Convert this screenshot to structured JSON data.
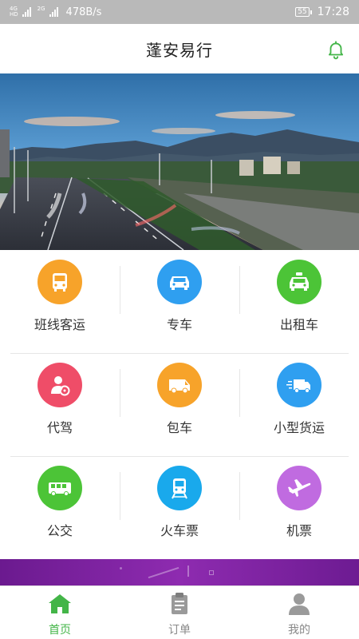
{
  "status_bar": {
    "net1_top": "4G",
    "net1_bottom": "HD",
    "net2_top": "2G",
    "speed": "478B/s",
    "battery": "55",
    "time": "17:28"
  },
  "header": {
    "title": "蓬安易行",
    "bell_icon": "bell-icon"
  },
  "services": [
    {
      "label": "班线客运",
      "icon": "bus-front-icon",
      "color": "#f7a32a"
    },
    {
      "label": "专车",
      "icon": "car-front-icon",
      "color": "#2f9ff0"
    },
    {
      "label": "出租车",
      "icon": "taxi-icon",
      "color": "#4cc437"
    },
    {
      "label": "代驾",
      "icon": "driver-icon",
      "color": "#ef4d68"
    },
    {
      "label": "包车",
      "icon": "van-icon",
      "color": "#f7a32a"
    },
    {
      "label": "小型货运",
      "icon": "truck-icon",
      "color": "#2f9ff0"
    },
    {
      "label": "公交",
      "icon": "bus-side-icon",
      "color": "#4cc437"
    },
    {
      "label": "火车票",
      "icon": "train-icon",
      "color": "#19a9ec"
    },
    {
      "label": "机票",
      "icon": "plane-icon",
      "color": "#c06be0"
    }
  ],
  "tabbar": [
    {
      "label": "首页",
      "icon": "home-icon",
      "active": true,
      "color": "#43b548"
    },
    {
      "label": "订单",
      "icon": "clipboard-icon",
      "active": false,
      "color": "#9a9a9a"
    },
    {
      "label": "我的",
      "icon": "user-icon",
      "active": false,
      "color": "#9a9a9a"
    }
  ]
}
